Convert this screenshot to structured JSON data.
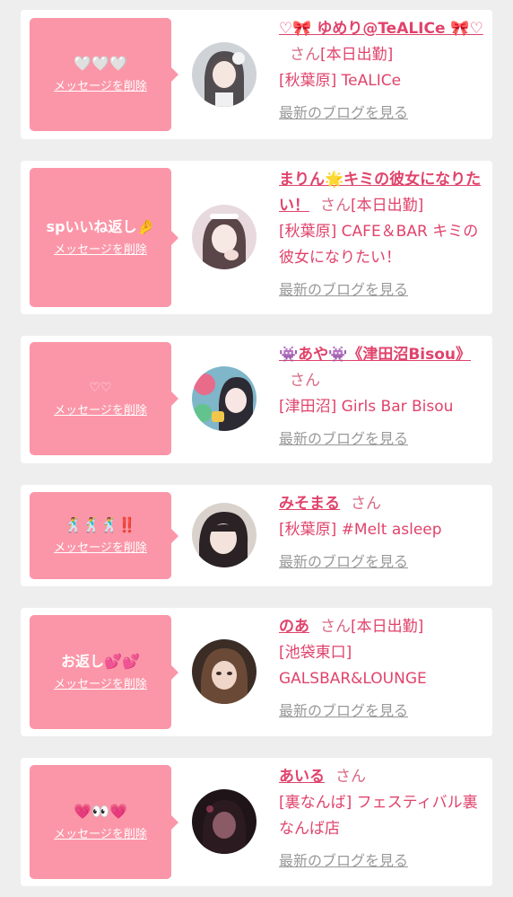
{
  "delete_label": "メッセージを削除",
  "blog_label": "最新のブログを見る",
  "colors": {
    "bubble": "#fb96a8",
    "accent": "#e0436b",
    "background": "#eeeeee"
  },
  "cards": [
    {
      "message": "🤍🤍🤍",
      "name": "♡🎀 ゆめり@TeALICe 🎀♡",
      "san": "さん",
      "status": "[本日出勤]",
      "shop": "[秋葉原] TeALICe",
      "avatar_icon": "girl-photo-avatar"
    },
    {
      "message": "spいいね返し🤌",
      "name": "まりん🌟キミの彼女になりたい！",
      "san": "さん",
      "status": "[本日出勤]",
      "shop": "[秋葉原] CAFE＆BAR キミの彼女になりたい！",
      "avatar_icon": "girl-photo-avatar"
    },
    {
      "message": "♡♡",
      "name": "👾あや👾《津田沼Bisou》",
      "san": "さん",
      "status": "",
      "shop": "[津田沼] Girls Bar Bisou",
      "avatar_icon": "girl-photo-avatar"
    },
    {
      "message": "🕺🕺🕺‼️",
      "name": "みそまる",
      "san": "さん",
      "status": "",
      "shop": "[秋葉原] #Melt asleep",
      "avatar_icon": "girl-photo-avatar"
    },
    {
      "message": "お返し💕💕",
      "name": "のあ",
      "san": "さん",
      "status": "[本日出勤]",
      "shop": "[池袋東口] GALSBAR&LOUNGE",
      "avatar_icon": "girl-photo-avatar"
    },
    {
      "message": "💗👀💗",
      "name": "あいる",
      "san": "さん",
      "status": "",
      "shop": "[裏なんば] フェスティバル裏なんば店",
      "avatar_icon": "girl-photo-avatar"
    }
  ]
}
